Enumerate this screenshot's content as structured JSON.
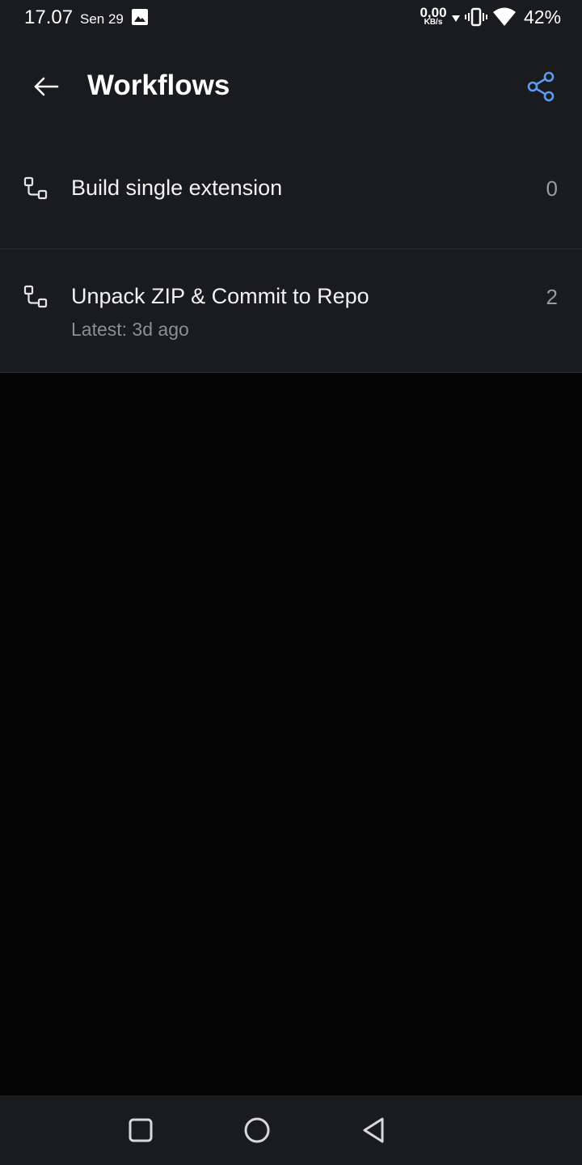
{
  "status_bar": {
    "time": "17.07",
    "date": "Sen 29",
    "net_speed": "0,00",
    "net_unit": "KB/s",
    "battery": "42%",
    "icons": [
      "gallery-icon",
      "data-arrow-icon",
      "vibrate-icon",
      "wifi-icon"
    ]
  },
  "app_bar": {
    "title": "Workflows",
    "back_icon": "arrow-left-icon",
    "share_icon": "share-icon",
    "accent": "#5b9bf0"
  },
  "workflows": [
    {
      "name": "Build single extension",
      "subtitle": "",
      "count": "0",
      "icon": "workflow-icon"
    },
    {
      "name": "Unpack ZIP & Commit to Repo",
      "subtitle": "Latest: 3d ago",
      "count": "2",
      "icon": "workflow-icon"
    }
  ],
  "nav_bar": {
    "icons": [
      "recents-square-icon",
      "home-circle-icon",
      "back-triangle-icon"
    ]
  },
  "colors": {
    "surface": "#1a1b1f",
    "background": "#050505",
    "divider": "#2c2d31",
    "secondary_text": "#8c8e94"
  }
}
